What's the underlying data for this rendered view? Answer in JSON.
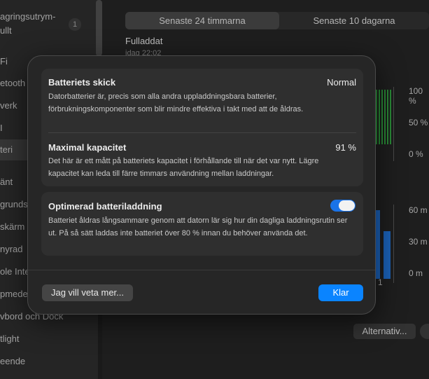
{
  "sidebar": {
    "items": [
      {
        "label": "agringsutrym-"
      },
      {
        "label": "ullt"
      },
      {
        "label": "Fi"
      },
      {
        "label": "etooth"
      },
      {
        "label": "verk"
      },
      {
        "label": "I"
      },
      {
        "label": "teri"
      },
      {
        "label": "änt"
      },
      {
        "label": "grunds"
      },
      {
        "label": "skärm"
      },
      {
        "label": "nyrad"
      },
      {
        "label": "ole Inte"
      },
      {
        "label": "pmede"
      },
      {
        "label": "vbord och Dock"
      },
      {
        "label": "tlight"
      },
      {
        "label": "eende"
      }
    ],
    "badge": "1"
  },
  "background": {
    "tabs": [
      "Senaste 24 timmarna",
      "Senaste 10 dagarna"
    ],
    "status_title": "Fulladdat",
    "status_sub": "idag 22:02",
    "battery_axis": [
      "100 %",
      "50 %",
      "0 %"
    ],
    "usage_axis": [
      "60 m",
      "30 m",
      "0 m"
    ],
    "tick_a": "1",
    "tick_b": "1",
    "options_button": "Alternativ..."
  },
  "modal": {
    "battery_health": {
      "title": "Batteriets skick",
      "value": "Normal",
      "description": "Datorbatterier är, precis som alla andra uppladdningsbara batterier, förbrukningskomponenter som blir mindre effektiva i takt med att de åldras."
    },
    "max_capacity": {
      "title": "Maximal kapacitet",
      "value": "91 %",
      "description": "Det här är ett mått på batteriets kapacitet i förhållande till när det var nytt. Lägre kapacitet kan leda till färre timmars användning mellan laddningar."
    },
    "optimized_charging": {
      "title": "Optimerad batteriladdning",
      "enabled": true,
      "description": "Batteriet åldras långsammare genom att datorn lär sig hur din dagliga laddningsrutin ser ut. På så sätt laddas inte batteriet över 80 % innan du behöver använda det."
    },
    "learn_more_button": "Jag vill veta mer...",
    "done_button": "Klar"
  },
  "colors": {
    "accent": "#0a84ff",
    "toggle_on": "#1a73e8",
    "battery_bars": "#2f9e3e",
    "usage_bars": "#1f6fd1"
  }
}
